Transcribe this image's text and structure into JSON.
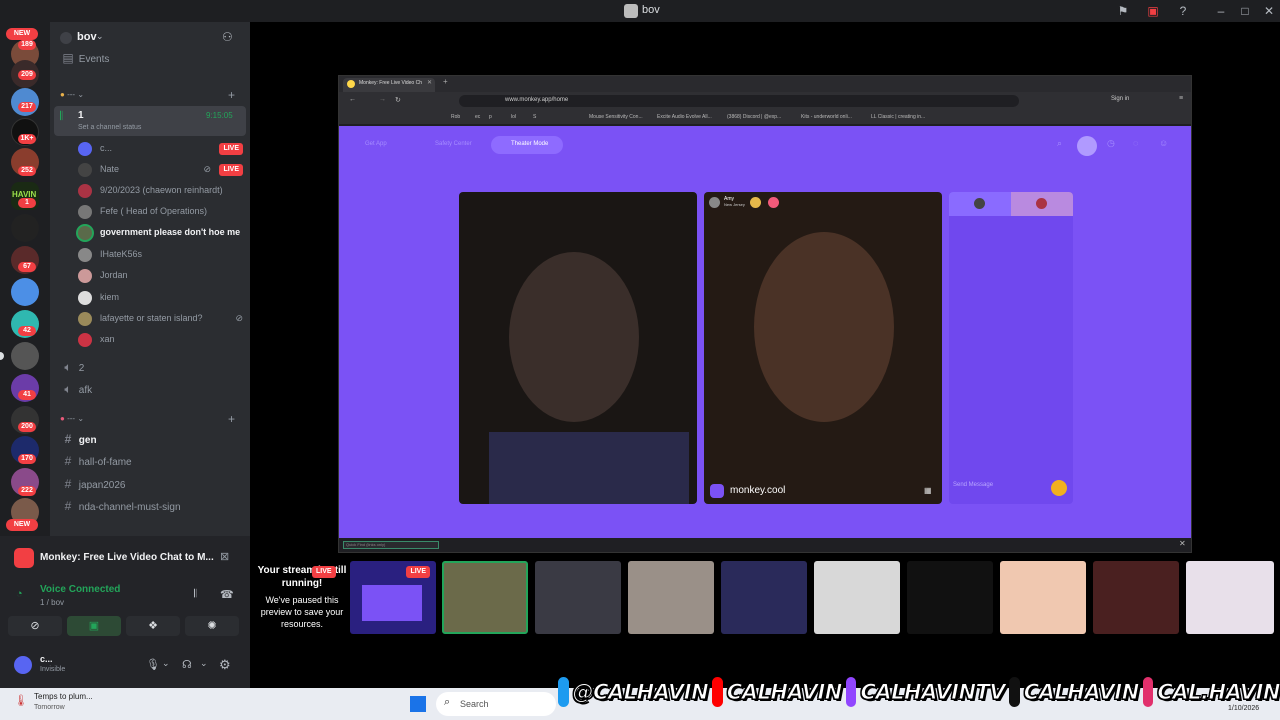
{
  "window": {
    "title": "bov"
  },
  "rail": {
    "new_top": "NEW",
    "new_bottom": "NEW",
    "badges": [
      "189",
      "209",
      "217",
      "1K+",
      "252",
      "1",
      "67",
      "42",
      "41",
      "200",
      "170",
      "222"
    ]
  },
  "server": {
    "name": "bov"
  },
  "channels": {
    "events": "Events",
    "category1": "---",
    "voice1": {
      "name": "1",
      "timer": "9:15:05",
      "status": "Set a channel status"
    },
    "voice_users": [
      {
        "name": "c...",
        "live": "LIVE"
      },
      {
        "name": "Nate",
        "live": "LIVE"
      },
      {
        "name": "9/20/2023 (chaewon reinhardt)"
      },
      {
        "name": "Fefe ( Head of Operations)"
      },
      {
        "name": "government please don't hoe me"
      },
      {
        "name": "IHateK56s"
      },
      {
        "name": "Jordan"
      },
      {
        "name": "kiem"
      },
      {
        "name": "lafayette or staten island?"
      },
      {
        "name": "xan"
      }
    ],
    "voice2": "2",
    "afk": "afk",
    "category2": "---",
    "text_channels": [
      "gen",
      "hall-of-fame",
      "japan2026",
      "nda-channel-must-sign"
    ]
  },
  "activity": {
    "title": "Monkey: Free Live Video Chat to M..."
  },
  "voice": {
    "status": "Voice Connected",
    "channel": "1 / bov"
  },
  "user": {
    "name": "c...",
    "status": "Invisible"
  },
  "browser": {
    "tab_title": "Monkey: Free Live Video Ch",
    "url": "www.monkey.app/home",
    "bookmarks": [
      "Rob",
      "ec",
      "p",
      "lol",
      "S",
      "Mouse Sensitivity Con...",
      "Excite Audio Evolve All...",
      "(3868) Discord | @exp...",
      "Kits - underworld onli...",
      "LL Classic | creating in..."
    ],
    "signin": "Sign in",
    "nav": {
      "get_app": "Get App",
      "safety": "Safety Center",
      "theater": "Theater Mode"
    },
    "remote_user": {
      "name": "Amy",
      "location": "New Jersey"
    },
    "watermark": "monkey.cool",
    "send_placeholder": "Send Message",
    "find_placeholder": "Quick Find (links only)"
  },
  "preview": {
    "message_title": "Your stream is still running!",
    "live": "LIVE",
    "message_body": "We've paused this preview to save your resources.",
    "live_thumb": "LIVE"
  },
  "taskbar": {
    "notification": "Temps to plum...",
    "notification_sub": "Tomorrow",
    "search_placeholder": "Search",
    "date": "1/10/2026"
  },
  "socials": [
    {
      "platform": "twitter",
      "handle": "@CALHAVIN"
    },
    {
      "platform": "youtube",
      "handle": "CALHAVIN"
    },
    {
      "platform": "twitch",
      "handle": "CALHAVINTV"
    },
    {
      "platform": "tiktok",
      "handle": "CALHAVIN"
    },
    {
      "platform": "instagram",
      "handle": "CAL.HAVIN"
    }
  ],
  "colors": {
    "discord_bg": "#2b2d31",
    "rail_bg": "#1e1f22",
    "live_red": "#f23f43",
    "monkey_purple": "#7b52f5",
    "voice_green": "#23a55a"
  }
}
